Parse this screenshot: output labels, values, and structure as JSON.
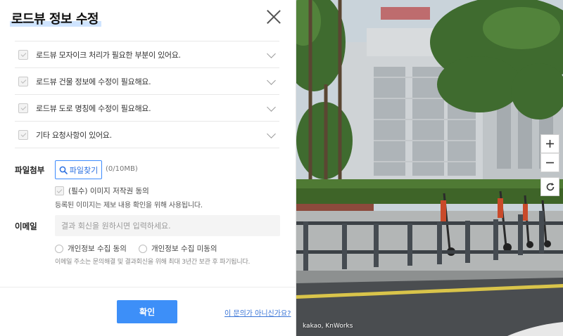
{
  "dialog": {
    "title": "로드뷰 정보 수정",
    "close_icon": "close-icon"
  },
  "options": [
    {
      "label": "로드뷰 모자이크 처리가 필요한 부분이 있어요."
    },
    {
      "label": "로드뷰 건물 정보에 수정이 필요해요."
    },
    {
      "label": "로드뷰 도로 명칭에 수정이 필요해요."
    },
    {
      "label": "기타 요청사항이 있어요."
    }
  ],
  "attachment": {
    "label": "파일첨부",
    "button_label": "파일찾기",
    "button_icon": "search-icon",
    "size_limit": "(0/10MB)",
    "consent_label": "(필수) 이미지 저작권 동의",
    "consent_note": "등록된 이미지는 제보 내용 확인을 위해 사용됩니다."
  },
  "email": {
    "label": "이메일",
    "placeholder": "결과 회신을 원하시면 입력하세요.",
    "value": "",
    "agree_label": "개인정보 수집 동의",
    "disagree_label": "개인정보 수집 미동의",
    "note": "이메일 주소는 문의해결 및 결과회신을 위해 최대 3년간 보관 후 파기됩니다."
  },
  "footer": {
    "confirm_label": "확인",
    "not_my_inquiry_label": "이 문의가 아니신가요?"
  },
  "map": {
    "copyright": "kakao, KnWorks",
    "zoom_in_icon": "plus-icon",
    "zoom_out_icon": "minus-icon",
    "reset_icon": "rotate-icon"
  },
  "colors": {
    "accent": "#3d8ff8",
    "link": "#3773d6",
    "title_highlight": "#cfe4ff"
  }
}
